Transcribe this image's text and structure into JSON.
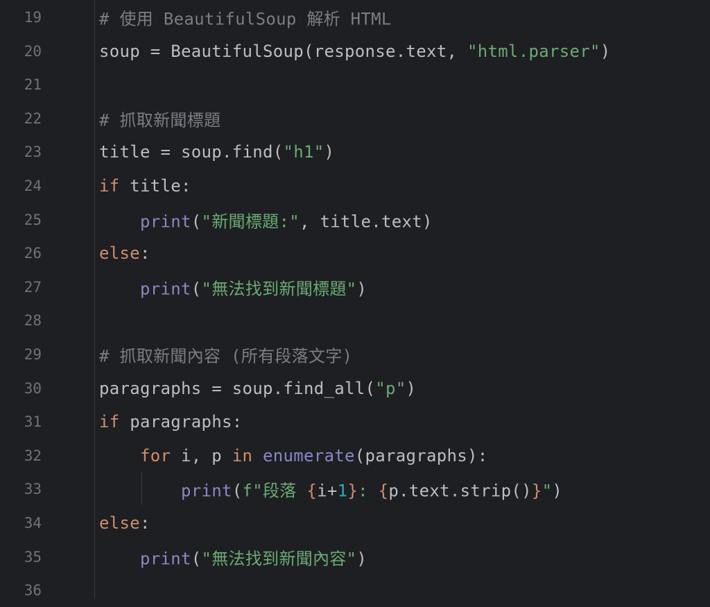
{
  "editor": {
    "colors": {
      "background": "#1e1f22",
      "line_number": "#6f737a",
      "default": "#bcbec4",
      "comment": "#7a7e85",
      "keyword": "#cf8e6d",
      "string": "#6aab73",
      "builtin": "#8888c6",
      "number": "#2aacb8"
    },
    "lines": [
      {
        "number": "19",
        "tokens": [
          {
            "t": "# 使用 BeautifulSoup 解析 HTML",
            "k": "comment"
          }
        ]
      },
      {
        "number": "20",
        "tokens": [
          {
            "t": "soup = BeautifulSoup(response.text, ",
            "k": "default"
          },
          {
            "t": "\"html.parser\"",
            "k": "string"
          },
          {
            "t": ")",
            "k": "default"
          }
        ]
      },
      {
        "number": "21",
        "tokens": []
      },
      {
        "number": "22",
        "tokens": [
          {
            "t": "# 抓取新聞標題",
            "k": "comment"
          }
        ]
      },
      {
        "number": "23",
        "tokens": [
          {
            "t": "title = soup.find(",
            "k": "default"
          },
          {
            "t": "\"h1\"",
            "k": "string"
          },
          {
            "t": ")",
            "k": "default"
          }
        ]
      },
      {
        "number": "24",
        "tokens": [
          {
            "t": "if",
            "k": "keyword"
          },
          {
            "t": " title:",
            "k": "default"
          }
        ]
      },
      {
        "number": "25",
        "tokens": [
          {
            "t": "    ",
            "k": "default"
          },
          {
            "t": "print",
            "k": "builtin"
          },
          {
            "t": "(",
            "k": "default"
          },
          {
            "t": "\"新聞標題:\"",
            "k": "string"
          },
          {
            "t": ", title.text)",
            "k": "default"
          }
        ]
      },
      {
        "number": "26",
        "tokens": [
          {
            "t": "else",
            "k": "keyword"
          },
          {
            "t": ":",
            "k": "default"
          }
        ]
      },
      {
        "number": "27",
        "tokens": [
          {
            "t": "    ",
            "k": "default"
          },
          {
            "t": "print",
            "k": "builtin"
          },
          {
            "t": "(",
            "k": "default"
          },
          {
            "t": "\"無法找到新聞標題\"",
            "k": "string"
          },
          {
            "t": ")",
            "k": "default"
          }
        ]
      },
      {
        "number": "28",
        "tokens": []
      },
      {
        "number": "29",
        "tokens": [
          {
            "t": "# 抓取新聞內容 (所有段落文字)",
            "k": "comment"
          }
        ]
      },
      {
        "number": "30",
        "tokens": [
          {
            "t": "paragraphs = soup.find_all(",
            "k": "default"
          },
          {
            "t": "\"p\"",
            "k": "string"
          },
          {
            "t": ")",
            "k": "default"
          }
        ]
      },
      {
        "number": "31",
        "tokens": [
          {
            "t": "if",
            "k": "keyword"
          },
          {
            "t": " paragraphs:",
            "k": "default"
          }
        ]
      },
      {
        "number": "32",
        "tokens": [
          {
            "t": "    ",
            "k": "default"
          },
          {
            "t": "for",
            "k": "keyword"
          },
          {
            "t": " i, p ",
            "k": "default"
          },
          {
            "t": "in",
            "k": "keyword"
          },
          {
            "t": " ",
            "k": "default"
          },
          {
            "t": "enumerate",
            "k": "builtin"
          },
          {
            "t": "(paragraphs):",
            "k": "default"
          }
        ]
      },
      {
        "number": "33",
        "tokens": [
          {
            "t": "        ",
            "k": "default"
          },
          {
            "t": "print",
            "k": "builtin"
          },
          {
            "t": "(",
            "k": "default"
          },
          {
            "t": "f\"段落 ",
            "k": "string"
          },
          {
            "t": "{",
            "k": "brace"
          },
          {
            "t": "i+",
            "k": "default"
          },
          {
            "t": "1",
            "k": "number"
          },
          {
            "t": "}",
            "k": "brace"
          },
          {
            "t": ": ",
            "k": "string"
          },
          {
            "t": "{",
            "k": "brace"
          },
          {
            "t": "p.text.strip()",
            "k": "default"
          },
          {
            "t": "}",
            "k": "brace"
          },
          {
            "t": "\"",
            "k": "string"
          },
          {
            "t": ")",
            "k": "default"
          }
        ]
      },
      {
        "number": "34",
        "tokens": [
          {
            "t": "else",
            "k": "keyword"
          },
          {
            "t": ":",
            "k": "default"
          }
        ]
      },
      {
        "number": "35",
        "tokens": [
          {
            "t": "    ",
            "k": "default"
          },
          {
            "t": "print",
            "k": "builtin"
          },
          {
            "t": "(",
            "k": "default"
          },
          {
            "t": "\"無法找到新聞內容\"",
            "k": "string"
          },
          {
            "t": ")",
            "k": "default"
          }
        ]
      },
      {
        "number": "36",
        "tokens": []
      }
    ]
  }
}
